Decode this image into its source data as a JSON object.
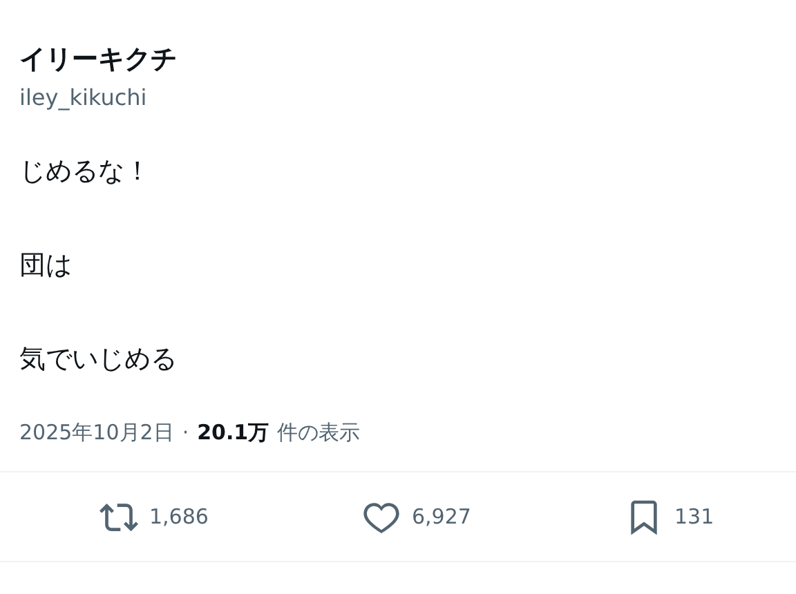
{
  "author": {
    "name": "イリーキクチ",
    "handle": "iley_kikuchi"
  },
  "body_lines": [
    "じめるな！",
    "団は",
    "気でいじめる"
  ],
  "meta": {
    "date": "2025年10月2日",
    "separator": "·",
    "views_count": "20.1万",
    "views_label": "件の表示"
  },
  "actions": [
    {
      "kind": "retweet",
      "count": "1,686"
    },
    {
      "kind": "like",
      "count": "6,927"
    },
    {
      "kind": "bookmark",
      "count": "131"
    }
  ]
}
